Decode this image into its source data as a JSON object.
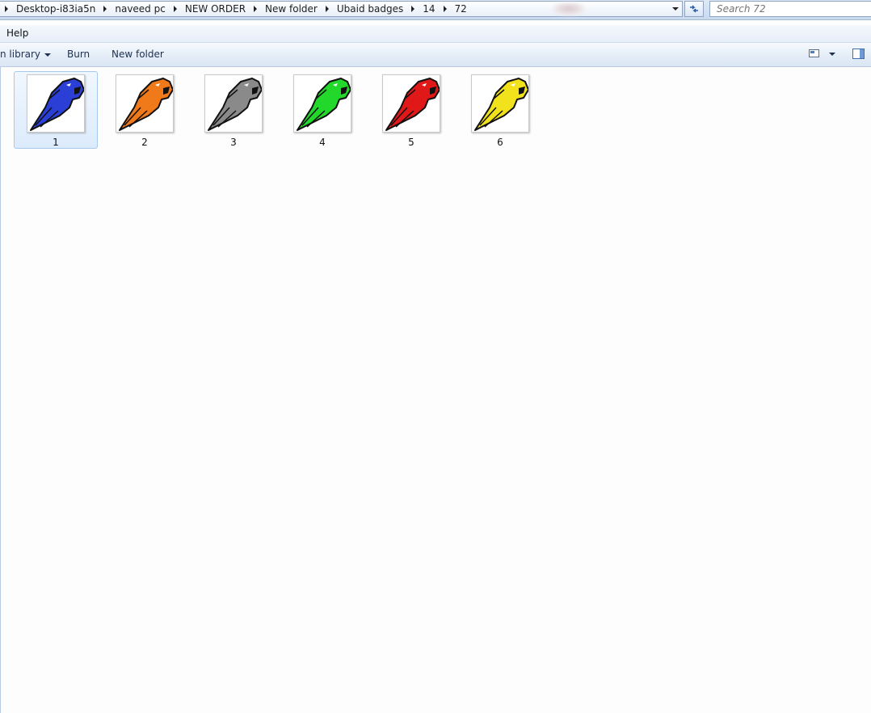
{
  "address_bar": {
    "crumbs": [
      "Desktop-i83ia5n",
      "naveed pc",
      "NEW ORDER",
      "New folder",
      "Ubaid badges",
      "14",
      "72"
    ]
  },
  "search": {
    "placeholder": "Search 72"
  },
  "menu": {
    "help": "Help"
  },
  "toolbar": {
    "include_library": "n library",
    "burn": "Burn",
    "new_folder": "New folder"
  },
  "files": [
    {
      "name": "1",
      "color": "#2b3fd6",
      "selected": true
    },
    {
      "name": "2",
      "color": "#f07a1a",
      "selected": false
    },
    {
      "name": "3",
      "color": "#8a8a8a",
      "selected": false
    },
    {
      "name": "4",
      "color": "#22d82a",
      "selected": false
    },
    {
      "name": "5",
      "color": "#e01818",
      "selected": false
    },
    {
      "name": "6",
      "color": "#f2e21c",
      "selected": false
    }
  ],
  "icons": {
    "refresh": "refresh-icon",
    "view": "change-view-icon",
    "preview_pane": "preview-pane-icon",
    "thumbnail": "panther-badge-thumbnail"
  }
}
